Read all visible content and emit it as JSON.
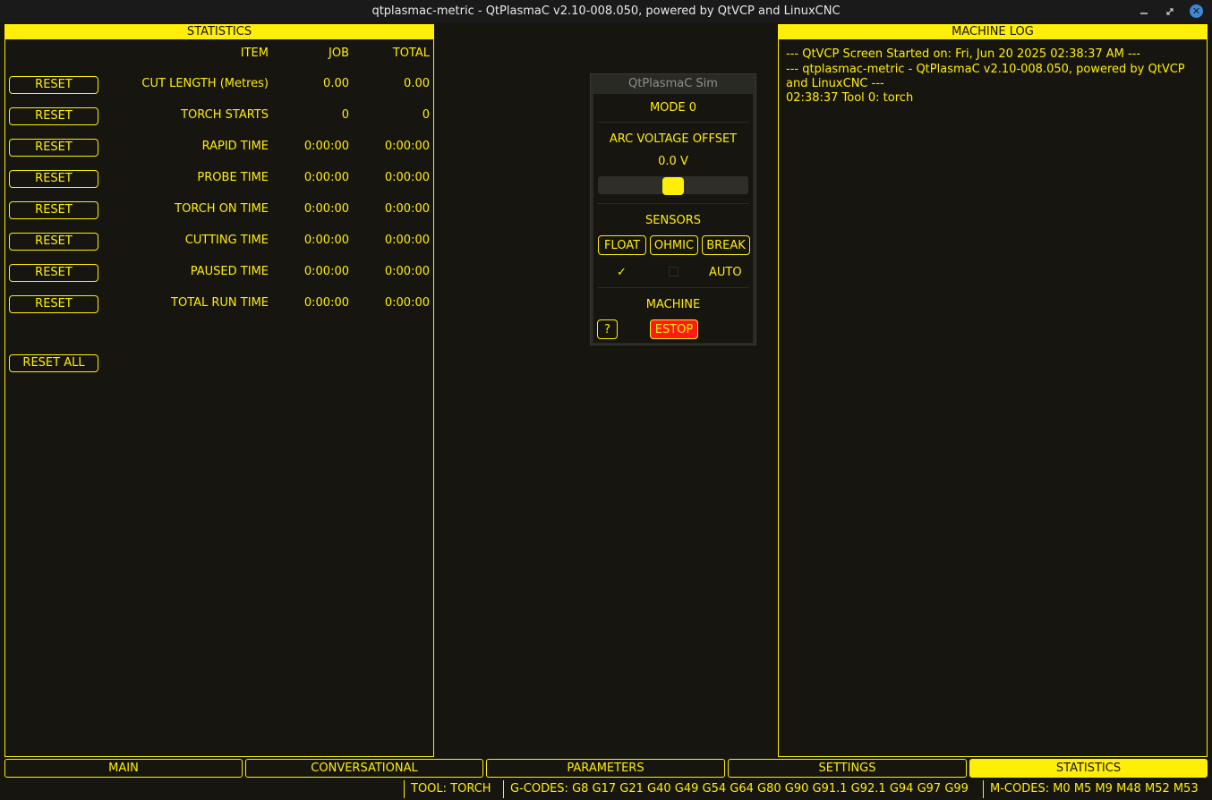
{
  "window": {
    "title": "qtplasmac-metric - QtPlasmaC v2.10-008.050, powered by QtVCP and LinuxCNC",
    "minimize_icon": "minimize-icon",
    "maximize_icon": "maximize-icon",
    "close_icon": "close-icon"
  },
  "statistics": {
    "header": "STATISTICS",
    "columns": {
      "item": "ITEM",
      "job": "JOB",
      "total": "TOTAL"
    },
    "reset_label": "RESET",
    "rows": [
      {
        "item": "CUT LENGTH (Metres)",
        "job": "0.00",
        "total": "0.00"
      },
      {
        "item": "TORCH STARTS",
        "job": "0",
        "total": "0"
      },
      {
        "item": "RAPID TIME",
        "job": "0:00:00",
        "total": "0:00:00"
      },
      {
        "item": "PROBE TIME",
        "job": "0:00:00",
        "total": "0:00:00"
      },
      {
        "item": "TORCH ON TIME",
        "job": "0:00:00",
        "total": "0:00:00"
      },
      {
        "item": "CUTTING TIME",
        "job": "0:00:00",
        "total": "0:00:00"
      },
      {
        "item": "PAUSED TIME",
        "job": "0:00:00",
        "total": "0:00:00"
      },
      {
        "item": "TOTAL RUN TIME",
        "job": "0:00:00",
        "total": "0:00:00"
      }
    ],
    "reset_all_label": "RESET ALL"
  },
  "machine_log": {
    "header": "MACHINE LOG",
    "lines": [
      "--- QtVCP Screen Started on: Fri, Jun 20 2025 02:38:37 AM ---",
      "--- qtplasmac-metric - QtPlasmaC v2.10-008.050, powered by QtVCP and LinuxCNC ---",
      "02:38:37 Tool 0: torch"
    ]
  },
  "sim": {
    "title": "QtPlasmaC Sim",
    "mode": "MODE 0",
    "arc_voltage_offset_label": "ARC VOLTAGE OFFSET",
    "arc_voltage_value": "0.0 V",
    "arc_voltage_slider_level": 0.5,
    "sensors_label": "SENSORS",
    "float_label": "FLOAT",
    "ohmic_label": "OHMIC",
    "break_label": "BREAK",
    "float_check": "✓",
    "auto_label": "AUTO",
    "machine_label": "MACHINE",
    "help_label": "?",
    "estop_label": "ESTOP",
    "estop_color": "#ff1a1a"
  },
  "tabs": [
    {
      "label": "MAIN",
      "active": false
    },
    {
      "label": "CONVERSATIONAL",
      "active": false
    },
    {
      "label": "PARAMETERS",
      "active": false
    },
    {
      "label": "SETTINGS",
      "active": false
    },
    {
      "label": "STATISTICS",
      "active": true
    }
  ],
  "statusbar": {
    "tool": "TOOL:   TORCH",
    "gcodes": "G-CODES:   G8 G17 G21 G40 G49 G54 G64 G80 G90 G91.1 G92.1 G94 G97 G99",
    "mcodes": "M-CODES:   M0 M5 M9 M48 M52 M53"
  },
  "colors": {
    "accent": "#ffee06",
    "background": "#16150f"
  }
}
